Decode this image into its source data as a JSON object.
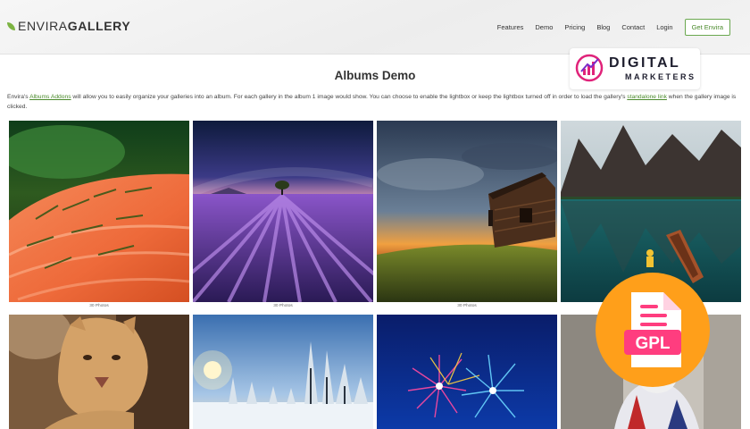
{
  "header": {
    "logo_part1": "ENVIRA",
    "logo_part2": "GALLERY",
    "nav": [
      "Features",
      "Demo",
      "Pricing",
      "Blog",
      "Contact",
      "Login"
    ],
    "cta": "Get Envira"
  },
  "main": {
    "title": "Albums Demo",
    "intro": {
      "t1": "Envira's ",
      "link1": "Albums Addons",
      "t2": " will allow you to easily organize your galleries into an album. For each gallery in the album 1 image would show. You can choose to enable the lightbox or keep the lightbox turned off in order to load the gallery's ",
      "link2": "standalone link",
      "t3": " when the gallery image is clicked."
    },
    "captions": [
      "30 Photos",
      "30 Photos",
      "30 Photos"
    ]
  },
  "overlay": {
    "brand_line1": "DIGITAL",
    "brand_line2": "MARKETERS",
    "gpl_label": "GPL"
  },
  "colors": {
    "accent_green": "#4a8a2b",
    "gpl_orange": "#ff9f1a",
    "gpl_pink": "#ff3d7f",
    "brand_magenta": "#e0237a"
  }
}
